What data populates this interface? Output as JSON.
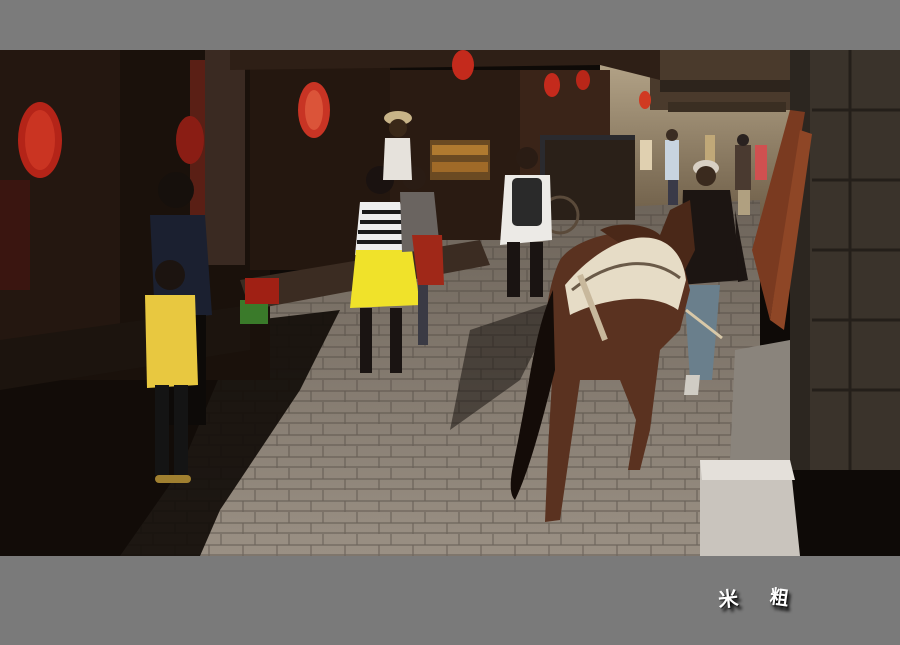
{
  "photo": {
    "subject": "street-scene",
    "colors": {
      "frame": "#7a7a7a",
      "shadow": "#0e0a07",
      "sunlit_stone": "#8f857a",
      "lantern": "#c0281c",
      "horse": "#5a3220",
      "yellow_skirt": "#f0e22a"
    }
  },
  "signature": {
    "char_1": "米",
    "char_2": "粗"
  }
}
